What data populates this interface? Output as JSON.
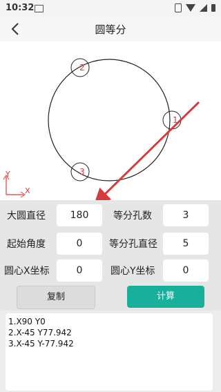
{
  "status_bar": {
    "time": "10:32"
  },
  "app_bar": {
    "title": "圆等分"
  },
  "diagram": {
    "hole_labels": [
      "1",
      "2",
      "3"
    ],
    "axis_y": "Y",
    "axis_x": "X",
    "colors": {
      "hole_label": "#e03a3a",
      "arrow": "#d63c3c",
      "axes": "#e03a3a"
    }
  },
  "form": {
    "big_diameter_label": "大圆直径",
    "big_diameter_value": "180",
    "holes_label": "等分孔数",
    "holes_value": "3",
    "start_angle_label": "起始角度",
    "start_angle_value": "0",
    "hole_diameter_label": "等分孔直径",
    "hole_diameter_value": "5",
    "center_x_label": "圆心X坐标",
    "center_x_value": "0",
    "center_y_label": "圆心Y坐标",
    "center_y_value": "0"
  },
  "buttons": {
    "copy": "复制",
    "calc": "计算"
  },
  "output_lines": [
    "1.X90 Y0",
    "2.X-45 Y77.942",
    "3.X-45 Y-77.942"
  ]
}
